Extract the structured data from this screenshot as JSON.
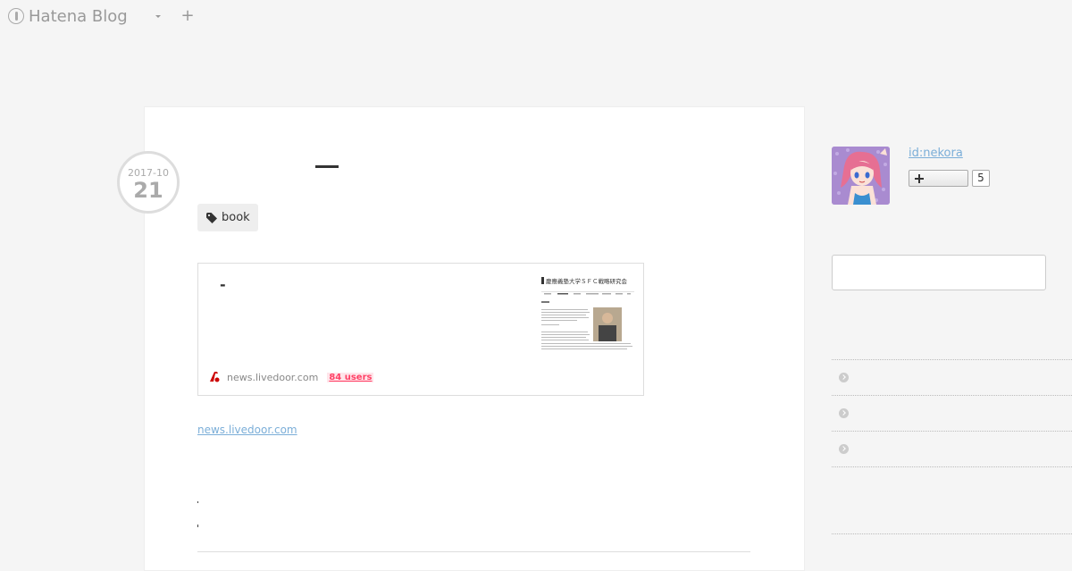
{
  "header": {
    "logo_text": "Hatena Blog",
    "logo_icon": "hatena-logo-icon",
    "dropdown_icon": "chevron-down-icon",
    "add_icon": "plus-icon"
  },
  "entry": {
    "date_year_month": "2017-10",
    "date_day": "21",
    "tag_label": "book",
    "tag_icon": "tag-icon",
    "embed": {
      "title": "-",
      "domain": "news.livedoor.com",
      "users": "84 users",
      "thumb_header": "慶應義塾大学ＳＦＣ戦略研究会"
    },
    "source_link": "news.livedoor.com"
  },
  "sidebar": {
    "user_id": "id:nekora",
    "subscribe_count": "5",
    "search_placeholder": "",
    "items": [
      {
        "label": ""
      },
      {
        "label": ""
      },
      {
        "label": ""
      }
    ]
  },
  "colors": {
    "background": "#f5f5f5",
    "link": "#7baed8",
    "users_badge": "#ff4166"
  }
}
